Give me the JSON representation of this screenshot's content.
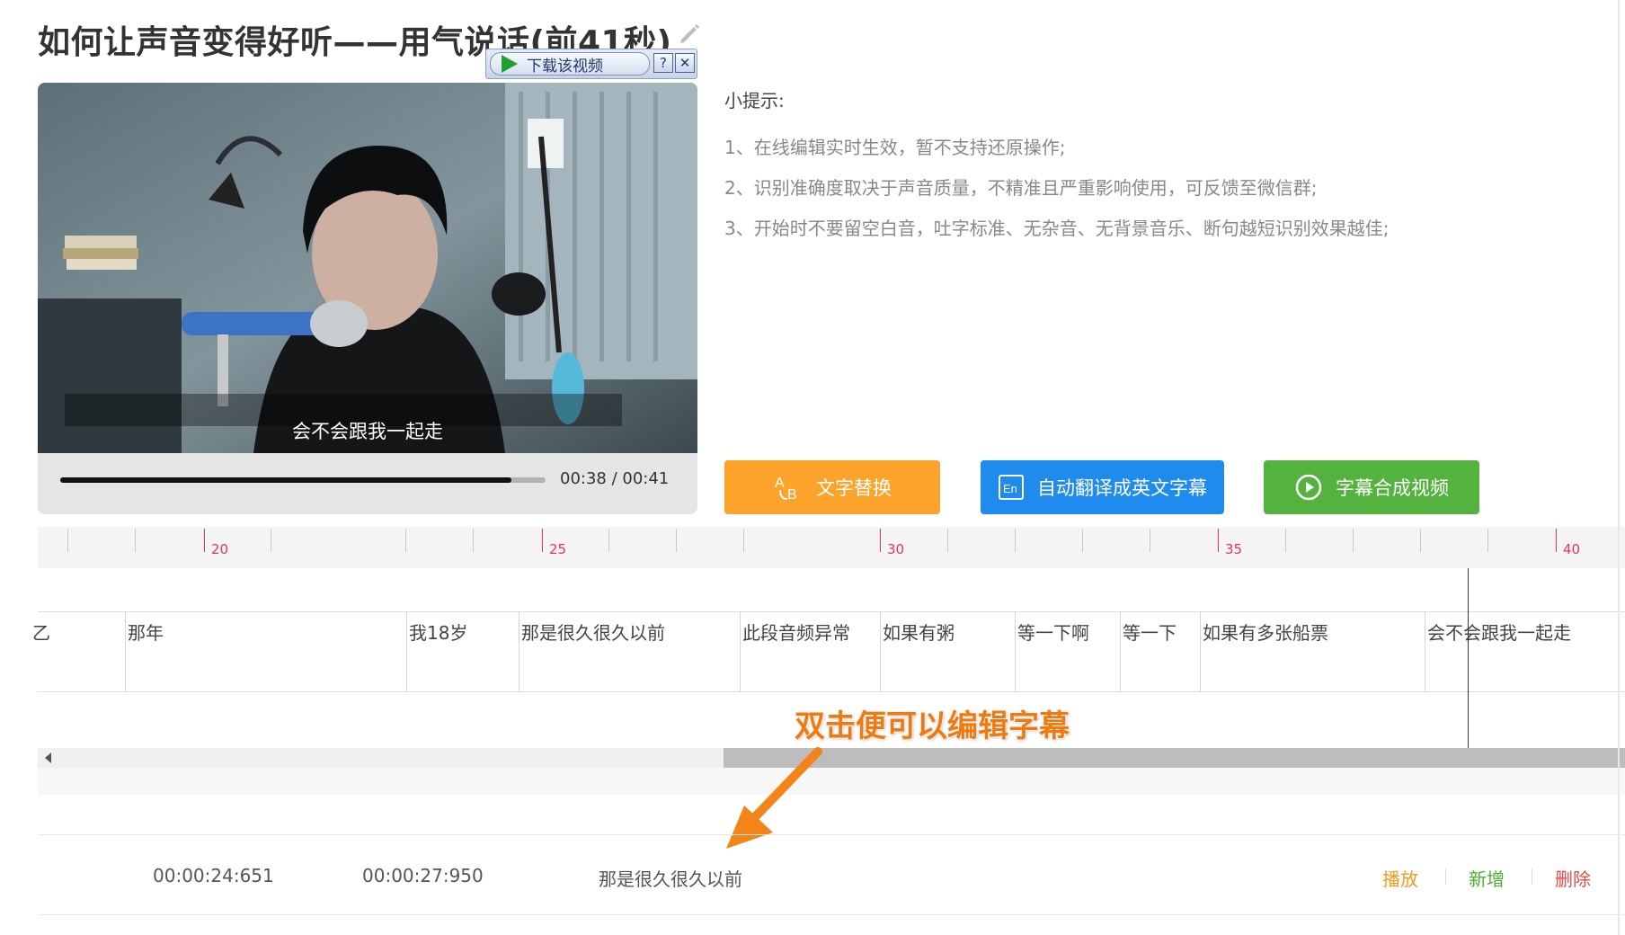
{
  "page": {
    "title": "如何让声音变得好听——用气说话(前41秒)"
  },
  "download_toolbar": {
    "label": "下载该视频",
    "help": "?",
    "close": "✕"
  },
  "player": {
    "subtitle": "会不会跟我一起走",
    "time": "00:38 / 00:41",
    "progress": 0.93
  },
  "tips": {
    "title": "小提示:",
    "items": [
      "1、在线编辑实时生效，暂不支持还原操作;",
      "2、识别准确度取决于声音质量，不精准且严重影响使用，可反馈至微信群;",
      "3、开始时不要留空白音，吐字标准、无杂音、无背景音乐、断句越短识别效果越佳;"
    ]
  },
  "actions": {
    "replace": "文字替换",
    "translate": "自动翻译成英文字幕",
    "merge": "字幕合成视频"
  },
  "timeline": {
    "ruler_labels": [
      "20",
      "25",
      "30",
      "35",
      "40"
    ],
    "segments": [
      "乙",
      "那年",
      "我18岁",
      "那是很久很久以前",
      "此段音频异常",
      "如果有粥",
      "等一下啊",
      "等一下",
      "如果有多张船票",
      "会不会跟我一起走"
    ],
    "callout": "双击便可以编辑字幕"
  },
  "subtitle_row": {
    "start": "00:00:24:651",
    "end": "00:00:27:950",
    "text": "那是很久很久以前",
    "ops": {
      "play": "播放",
      "add": "新增",
      "delete": "删除"
    }
  },
  "colors": {
    "replace": "#fba32b",
    "translate": "#1f8ced",
    "merge": "#54b33e",
    "tick_major": "#e2365e",
    "callout": "#f07a12",
    "op_play": "#f39a1e",
    "op_add": "#4caf31",
    "op_delete": "#e84b4b"
  },
  "icons": [
    "edit-pencil-icon",
    "play-triangle-icon",
    "text-replace-icon",
    "translate-en-icon",
    "merge-video-icon",
    "arrow-pointer-icon"
  ]
}
